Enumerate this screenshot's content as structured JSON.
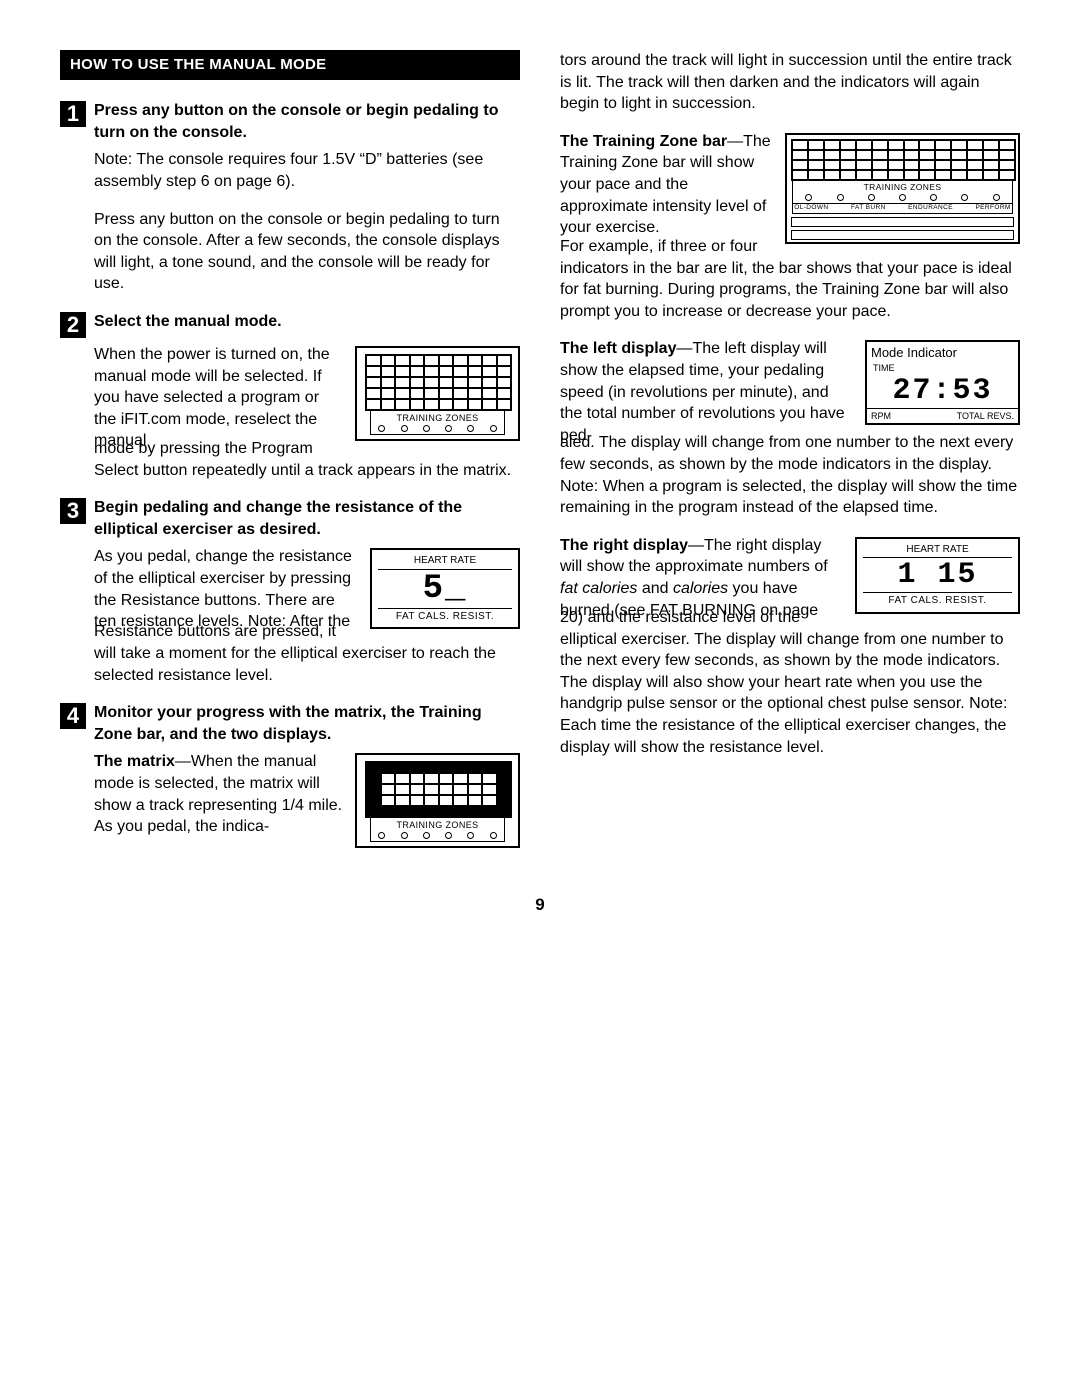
{
  "header": "HOW TO USE THE MANUAL MODE",
  "page_number": "9",
  "left": {
    "step1": {
      "num": "1",
      "title": "Press any button on the console or begin pedaling to turn on the console.",
      "p1": "Note: The console requires four 1.5V “D” batteries (see assembly step 6 on page 6).",
      "p2": "Press any button on the console or begin pedaling to turn on the console. After a few seconds, the console displays will light, a tone sound, and the console will be ready for use."
    },
    "step2": {
      "num": "2",
      "title": "Select the manual mode.",
      "p1a": "When the power is turned on, the manual mode will be selected. If you have selected a program or the iFIT.com mode, reselect the manual",
      "p1b": "mode by pressing the Program Select button repeatedly until a track appears in the matrix.",
      "tz_label": "TRAINING ZONES"
    },
    "step3": {
      "num": "3",
      "title": "Begin pedaling and change the resistance of the elliptical exerciser as desired.",
      "p1a": "As you pedal, change the resistance of the elliptical exerciser by pressing the Resistance buttons. There are ten resistance levels. Note: After the",
      "p1b": "Resistance buttons are pressed, it will take a moment for the elliptical exerciser to reach the selected resistance level.",
      "hr_top": "HEART RATE",
      "hr_val": "5_",
      "hr_bot": "FAT CALS.  RESIST."
    },
    "step4": {
      "num": "4",
      "title": "Monitor your progress with the matrix, the Training Zone bar, and the two displays.",
      "p_lead": "The matrix",
      "p1a": "—When the manual mode is selected, the matrix will show a track representing 1/4 mile. As you pedal, the indica-",
      "tz_label": "TRAINING ZONES"
    }
  },
  "right": {
    "p_cont": "tors around the track will light in succession until the entire track is lit. The track will then darken and the indicators will again begin to light in succession.",
    "tz": {
      "lead": "The Training Zone bar",
      "p1a": "—The Training Zone bar will show your pace and the approximate intensity level of your exercise.",
      "p1b": "For example, if three or four indicators in the bar are lit, the bar shows that your pace is ideal for fat burning. During programs, the Training Zone bar will also prompt you to increase or decrease your pace.",
      "label": "TRAINING ZONES",
      "sub1": "OL-DOWN",
      "sub2": "FAT BURN",
      "sub3": "ENDURANCE",
      "sub4": "PERFORM"
    },
    "ld": {
      "lead": "The left display",
      "p1a": "—The left display will show the elapsed time, your pedaling speed (in revolutions per minute), and the total number of revolutions you have ped-",
      "p1b": "aled. The display will change from one number to the next every few seconds, as shown by the mode indicators in the display. Note: When a program is selected, the display will show the time remaining in the program instead of the elapsed time.",
      "mode_ind": "Mode Indicator",
      "time": "TIME",
      "val": "27:53",
      "rpm": "RPM",
      "tot": "TOTAL REVS."
    },
    "rd": {
      "lead": "The right display",
      "p1a": "—The right display will show the approximate numbers of ",
      "it1": "fat calories",
      "mid": " and ",
      "it2": "calories",
      "p1a2": " you have burned (see FAT BURNING on page",
      "p1b": "20) and the resistance level of the elliptical exerciser. The display will change from one number to the next every few seconds, as shown by the mode indicators. The display will also show your heart rate when you use the handgrip pulse sensor or the optional chest pulse sensor. Note: Each time the resistance of the elliptical exerciser changes, the display will show the resistance level.",
      "hr_top": "HEART RATE",
      "val": "1 15",
      "hr_bot": "FAT CALS.  RESIST."
    }
  }
}
